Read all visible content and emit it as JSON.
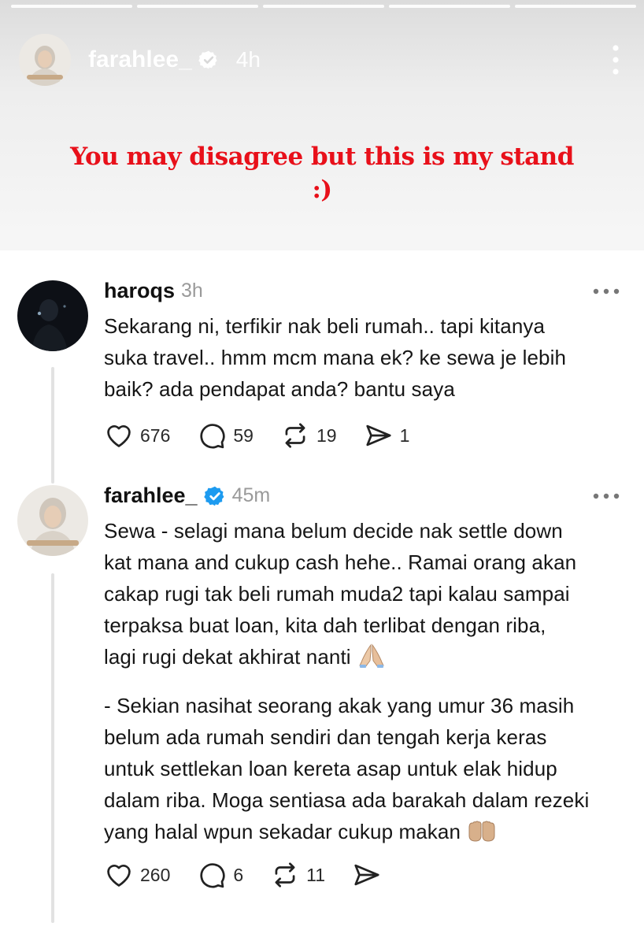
{
  "story": {
    "username": "farahlee_",
    "time": "4h",
    "caption_line1": "You may disagree but this is my stand",
    "caption_line2": ":)"
  },
  "posts": [
    {
      "username": "haroqs",
      "time": "3h",
      "verified": false,
      "text_lines": [
        "Sekarang ni, terfikir nak beli rumah.. tapi kitanya",
        "suka travel.. hmm mcm mana ek? ke sewa je lebih",
        "baik? ada pendapat anda? bantu saya"
      ],
      "likes": "676",
      "replies": "59",
      "reposts": "19",
      "shares": "1"
    },
    {
      "username": "farahlee_",
      "time": "45m",
      "verified": true,
      "para1_lines": [
        "Sewa - selagi mana belum decide nak settle down",
        "kat mana and cukup cash hehe.. Ramai orang akan",
        "cakap rugi tak beli rumah muda2 tapi kalau sampai",
        "terpaksa buat loan, kita dah terlibat dengan riba,",
        "lagi rugi dekat akhirat nanti"
      ],
      "para2_lines": [
        "- Sekian nasihat seorang akak yang umur 36 masih",
        "belum ada rumah sendiri dan tengah kerja keras",
        "untuk settlekan loan kereta asap untuk elak hidup",
        "dalam riba. Moga sentiasa ada barakah dalam rezeki",
        "yang halal wpun sekadar cukup makan"
      ],
      "likes": "260",
      "replies": "6",
      "reposts": "11"
    }
  ],
  "icons": {
    "heart": "heart-icon",
    "reply": "comment-icon",
    "repost": "repost-icon",
    "share": "send-icon",
    "verified": "verified-badge-icon",
    "more": "more-options-icon",
    "pray": "folded-hands-emoji",
    "open_hands": "palms-up-emoji"
  },
  "colors": {
    "caption": "#e8101a",
    "verified": "#1d9bf0",
    "muted": "#9a9a9a"
  }
}
